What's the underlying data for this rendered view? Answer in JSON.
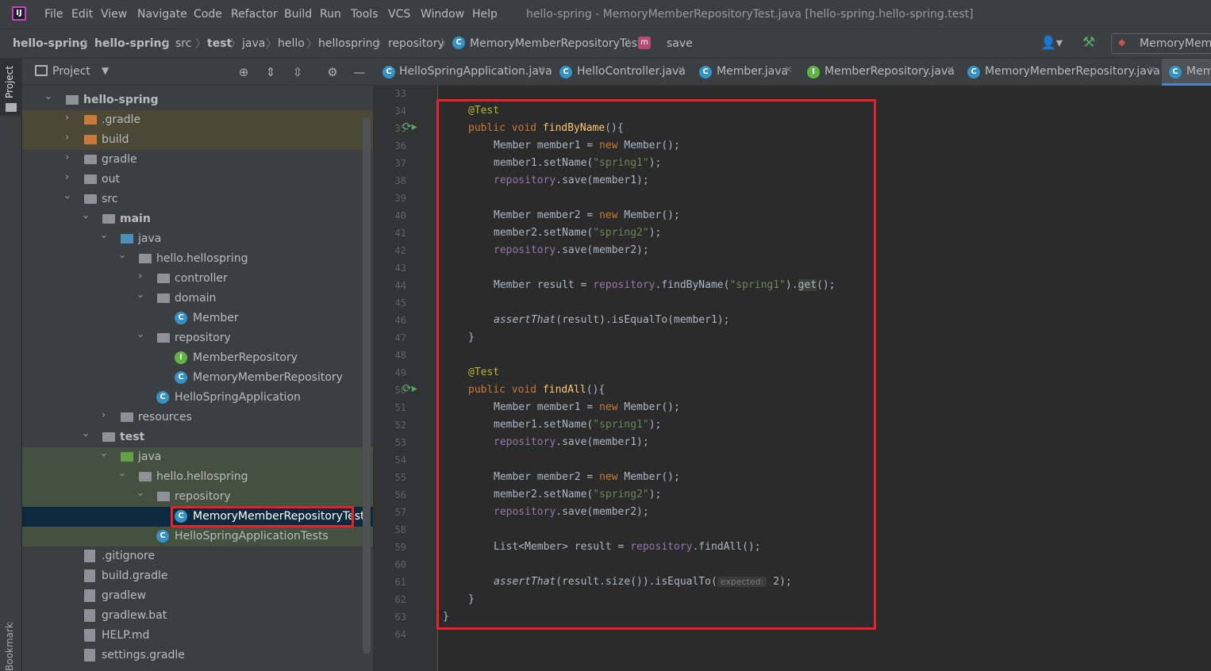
{
  "menubar": {
    "logo": "IJ",
    "items": [
      "File",
      "Edit",
      "View",
      "Navigate",
      "Code",
      "Refactor",
      "Build",
      "Run",
      "Tools",
      "VCS",
      "Window",
      "Help"
    ],
    "title": "hello-spring - MemoryMemberRepositoryTest.java [hello-spring.hello-spring.test]"
  },
  "breadcrumbs": {
    "items": [
      "hello-spring",
      "hello-spring",
      "src",
      "test",
      "java",
      "hello",
      "hellospring",
      "repository",
      "MemoryMemberRepositoryTest",
      "save"
    ],
    "run_config": "MemoryMemb"
  },
  "sidebar": {
    "project_label": "Project",
    "bookmarks_label": "Bookmarks"
  },
  "project_panel": {
    "title": "Project",
    "tree": [
      {
        "label": "hello-spring",
        "bold": true
      },
      {
        "label": ".gradle"
      },
      {
        "label": "build"
      },
      {
        "label": "gradle"
      },
      {
        "label": "out"
      },
      {
        "label": "src"
      },
      {
        "label": "main",
        "bold": true
      },
      {
        "label": "java"
      },
      {
        "label": "hello.hellospring"
      },
      {
        "label": "controller"
      },
      {
        "label": "domain"
      },
      {
        "label": "Member"
      },
      {
        "label": "repository"
      },
      {
        "label": "MemberRepository"
      },
      {
        "label": "MemoryMemberRepository"
      },
      {
        "label": "HelloSpringApplication"
      },
      {
        "label": "resources"
      },
      {
        "label": "test",
        "bold": true
      },
      {
        "label": "java"
      },
      {
        "label": "hello.hellospring"
      },
      {
        "label": "repository"
      },
      {
        "label": "MemoryMemberRepositoryTest"
      },
      {
        "label": "HelloSpringApplicationTests"
      },
      {
        "label": ".gitignore"
      },
      {
        "label": "build.gradle"
      },
      {
        "label": "gradlew"
      },
      {
        "label": "gradlew.bat"
      },
      {
        "label": "HELP.md"
      },
      {
        "label": "settings.gradle"
      }
    ]
  },
  "editor": {
    "tabs": [
      "HelloSpringApplication.java",
      "HelloController.java",
      "Member.java",
      "MemberRepository.java",
      "MemoryMemberRepository.java",
      "Mem"
    ],
    "line_numbers": [
      "33",
      "34",
      "35",
      "36",
      "37",
      "38",
      "39",
      "40",
      "41",
      "42",
      "43",
      "44",
      "45",
      "46",
      "47",
      "48",
      "49",
      "50",
      "51",
      "52",
      "53",
      "54",
      "55",
      "56",
      "57",
      "58",
      "59",
      "60",
      "61",
      "62",
      "63",
      "64"
    ],
    "code": {
      "test_annotation": "@Test",
      "public_void": "public void ",
      "find_by_name": "findByName",
      "find_all": "findAll",
      "open_sig": "(){",
      "member_kw": "Member member1 = ",
      "member2_kw": "Member member2 = ",
      "new_kw": "new",
      "member_ctor": " Member();",
      "set1": "member1.setName(",
      "set2": "member2.setName(",
      "spring1": "\"spring1\"",
      "spring2": "\"spring2\"",
      "close_paren": ");",
      "repository": "repository",
      "save1": ".save(member1);",
      "save2": ".save(member2);",
      "result_decl": "Member result = ",
      "find_call": ".findByName(",
      "dot": ").",
      "get": "get",
      "get_tail": "();",
      "assert": "assertThat",
      "assert_tail1": "(result).isEqualTo(member1);",
      "brace": "}",
      "list_decl": "List<Member> result = ",
      "find_all_call": ".findAll();",
      "assert_tail2a": "(result.size()).isEqualTo(",
      "hint": "expected:",
      "assert_tail2b": " 2);"
    }
  }
}
